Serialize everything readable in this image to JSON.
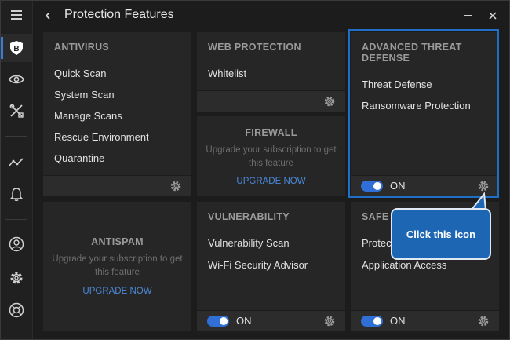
{
  "window": {
    "title": "Protection Features"
  },
  "sidebar": {
    "items": [
      {
        "name": "menu-icon"
      },
      {
        "name": "bitdefender-logo-icon",
        "label": "B"
      },
      {
        "name": "eye-icon"
      },
      {
        "name": "tools-icon"
      },
      {
        "name": "activity-icon"
      },
      {
        "name": "bell-icon"
      },
      {
        "name": "account-icon"
      },
      {
        "name": "settings-icon"
      },
      {
        "name": "support-icon"
      }
    ]
  },
  "cards": {
    "antivirus": {
      "title": "ANTIVIRUS",
      "items": [
        "Quick Scan",
        "System Scan",
        "Manage Scans",
        "Rescue Environment",
        "Quarantine"
      ]
    },
    "web_protection": {
      "title": "WEB PROTECTION",
      "items": [
        "Whitelist"
      ]
    },
    "advanced_threat_defense": {
      "title": "ADVANCED THREAT DEFENSE",
      "items": [
        "Threat Defense",
        "Ransomware Protection"
      ],
      "toggle": "ON"
    },
    "firewall": {
      "title": "FIREWALL",
      "text": "Upgrade your subscription to get this feature",
      "link": "UPGRADE NOW"
    },
    "antispam": {
      "title": "ANTISPAM",
      "text": "Upgrade your subscription to get this feature",
      "link": "UPGRADE NOW"
    },
    "vulnerability": {
      "title": "VULNERABILITY",
      "items": [
        "Vulnerability Scan",
        "Wi-Fi Security Advisor"
      ],
      "toggle": "ON"
    },
    "safe_files": {
      "title": "SAFE",
      "items": [
        "Protec",
        "Application Access"
      ],
      "toggle": "ON"
    }
  },
  "callout": {
    "text": "Click this icon"
  },
  "colors": {
    "accent": "#2f6fd6",
    "highlight": "#1f6fc7",
    "link": "#4a8ad9"
  }
}
